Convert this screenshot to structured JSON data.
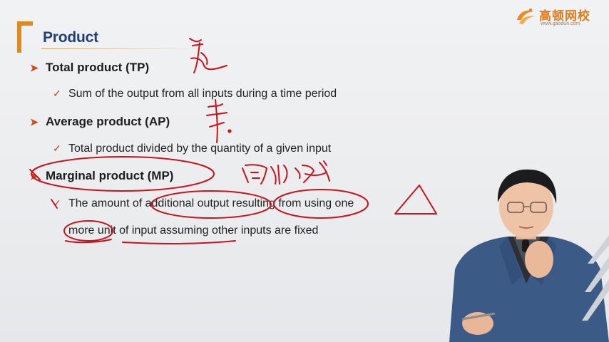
{
  "slide": {
    "title": "Product",
    "logo": {
      "name": "高顿网校",
      "url": "www.gaodun.com"
    },
    "bullets": [
      {
        "heading": "Total product (TP)",
        "detail": "Sum of the output from all inputs during a time period"
      },
      {
        "heading": "Average product (AP)",
        "detail": "Total product divided by the quantity of a given input"
      },
      {
        "heading": "Marginal product (MP)",
        "detail_line1": "The amount of additional output resulting from using one",
        "detail_line2": "more unit of input assuming other inputs are fixed"
      }
    ]
  },
  "icons": {
    "bullet": "arrowhead-bullet-icon",
    "sub_bullet": "checkmark-icon",
    "brand_logo": "gaodun-logo-icon"
  },
  "colors": {
    "accent_orange": "#e08a1e",
    "title_blue": "#1f3f7a",
    "bullet_red": "#d44a1e",
    "annotation_red": "#c8141e"
  }
}
